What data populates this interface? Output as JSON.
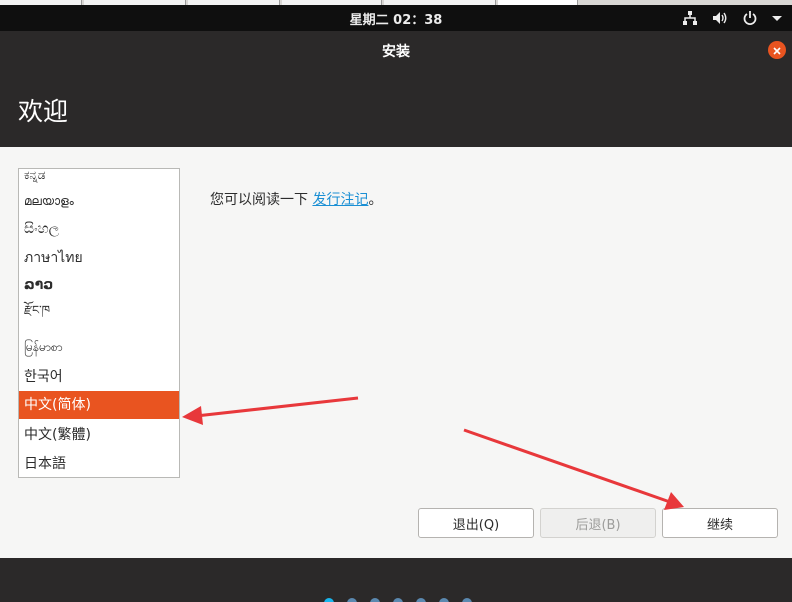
{
  "topbar": {
    "clock": "星期二 02：38"
  },
  "window": {
    "title": "安装",
    "header_title": "欢迎"
  },
  "languages": [
    "ಕನ್ನಡ",
    "മലയാളം",
    "සිංහල",
    "ภาษาไทย",
    "ລາວ",
    "རྫོང་ཁ",
    "မြန်မာစာ",
    "한국어",
    "中文(简体)",
    "中文(繁體)",
    "日本語"
  ],
  "selected_language": "中文(简体)",
  "release_notes": {
    "prefix": "您可以阅读一下 ",
    "link": "发行注记",
    "suffix": "。"
  },
  "buttons": {
    "quit": "退出(Q)",
    "back": "后退(B)",
    "continue": "继续"
  },
  "colors": {
    "accent": "#e95420",
    "link": "#1a8fd4",
    "annotation_arrow": "#e8383b"
  },
  "icons": [
    "network-icon",
    "volume-icon",
    "power-icon",
    "menu-arrow-icon",
    "close-icon"
  ]
}
